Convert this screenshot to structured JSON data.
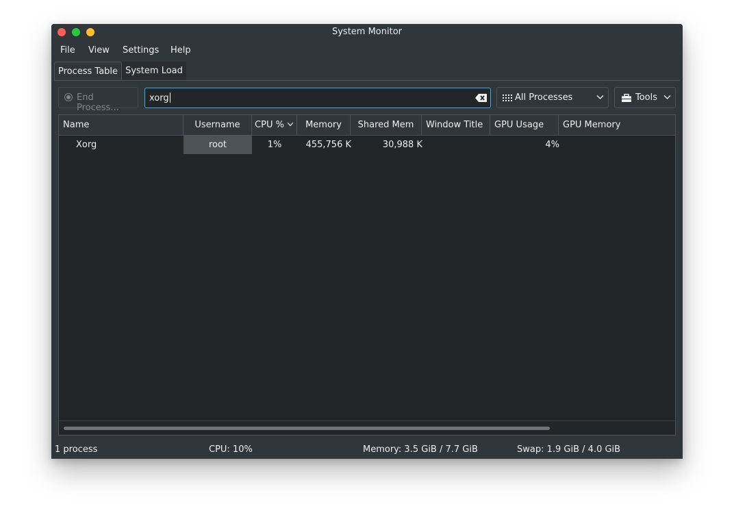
{
  "window": {
    "title": "System Monitor"
  },
  "menu": [
    "File",
    "View",
    "Settings",
    "Help"
  ],
  "tabs": [
    {
      "label": "Process Table",
      "active": true
    },
    {
      "label": "System Load",
      "active": false
    }
  ],
  "toolbar": {
    "end_process_label": "End Process...",
    "search_value": "xorg",
    "filter_label": "All Processes",
    "tools_label": "Tools"
  },
  "table": {
    "columns": [
      "Name",
      "Username",
      "CPU %",
      "Memory",
      "Shared Mem",
      "Window Title",
      "GPU Usage",
      "GPU Memory"
    ],
    "rows": [
      {
        "name": "Xorg",
        "username": "root",
        "cpu": "1%",
        "memory": "455,756 K",
        "shared_mem": "30,988 K",
        "window_title": "",
        "gpu_usage": "4%",
        "gpu_memory": ""
      }
    ]
  },
  "status": {
    "processes": "1 process",
    "cpu": "CPU: 10%",
    "memory": "Memory: 3.5 GiB / 7.7 GiB",
    "swap": "Swap: 1.9 GiB / 4.0 GiB"
  },
  "colors": {
    "window_bg": "#31363b",
    "view_bg": "#232629",
    "accent": "#3daee9",
    "close": "#ff5f57",
    "maximize": "#28c940",
    "minimize": "#febc2e"
  }
}
